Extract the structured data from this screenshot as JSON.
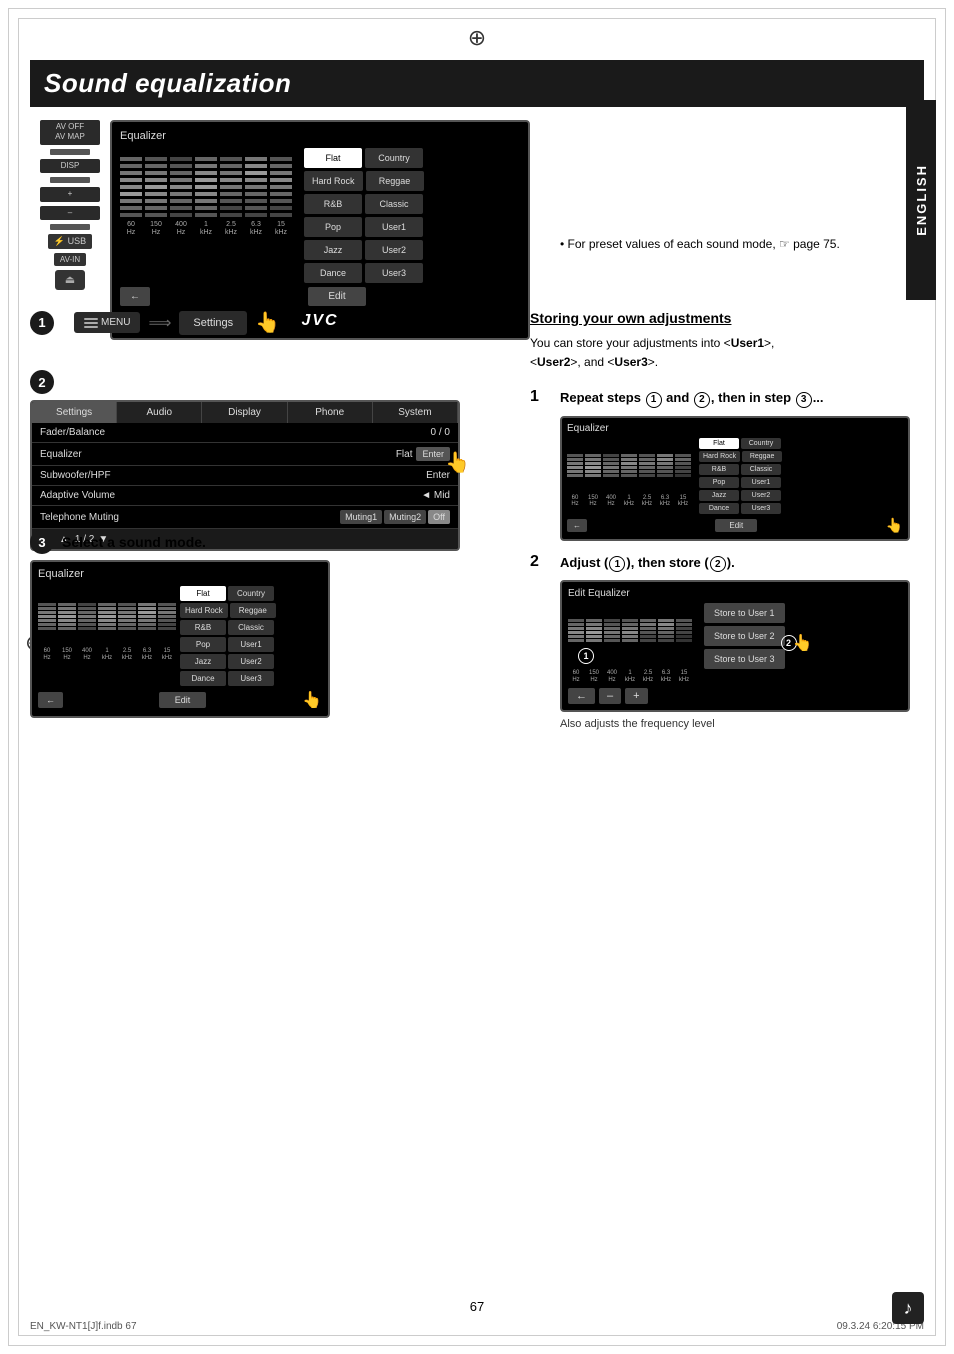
{
  "page": {
    "title": "Sound equalization",
    "page_number": "67",
    "footer_left": "EN_KW-NT1[J]f.indb   67",
    "footer_right": "09.3.24   6:20:15 PM"
  },
  "sidebar": {
    "label": "ENGLISH"
  },
  "device": {
    "buttons": [
      "AV OFF",
      "AV MAP",
      "DISP",
      "+",
      "–",
      "USB",
      "AV-IN"
    ]
  },
  "eq_main": {
    "title": "Equalizer",
    "labels": [
      "60 Hz",
      "150 Hz",
      "400 Hz",
      "1 kHz",
      "2.5 kHz",
      "6.3 kHz",
      "15 kHz"
    ],
    "buttons": {
      "flat": "Flat",
      "country": "Country",
      "hard_rock": "Hard Rock",
      "reggae": "Reggae",
      "rb": "R&B",
      "classic": "Classic",
      "pop": "Pop",
      "user1": "User1",
      "jazz": "Jazz",
      "user2": "User2",
      "dance": "Dance",
      "user3": "User3"
    },
    "bottom": {
      "back": "←",
      "edit": "Edit"
    },
    "logo": "JVC"
  },
  "note": {
    "text": "For preset values of each sound mode, ☞ page 75."
  },
  "step1": {
    "circle": "1",
    "menu_label": "MENU",
    "settings_label": "Settings"
  },
  "step2": {
    "circle": "2",
    "screen": {
      "tabs": [
        "Settings",
        "Audio",
        "Display",
        "Phone",
        "System"
      ],
      "rows": [
        {
          "label": "Fader/Balance",
          "value": "0 / 0"
        },
        {
          "label": "Equalizer",
          "value": "Flat"
        },
        {
          "label": "Subwoofer/HPF",
          "value": "Enter"
        },
        {
          "label": "Adaptive Volume",
          "value": "◄  Mid"
        },
        {
          "label": "Telephone Muting",
          "value": "Muting1  Muting2  Off"
        }
      ],
      "bottom": {
        "back": "←",
        "page": "1 / 2",
        "nav_up": "▲",
        "nav_down": "▼"
      }
    }
  },
  "step3": {
    "circle": "3",
    "label": "Select a sound mode.",
    "eq_title": "Equalizer",
    "buttons": {
      "flat": "Flat",
      "country": "Country",
      "hard_rock": "Hard Rock",
      "reggae": "Reggae",
      "rb": "R&B",
      "classic": "Classic",
      "pop": "Pop",
      "user1": "User1",
      "jazz": "Jazz",
      "user2": "User2",
      "dance": "Dance",
      "user3": "User3"
    },
    "edit": "Edit"
  },
  "storing": {
    "title": "Storing your own adjustments",
    "text": "You can store your adjustments into <User1>, <User2>, and <User3>.",
    "step1": {
      "num": "1",
      "label": "Repeat steps",
      "detail": " and , then in step ..."
    },
    "step2": {
      "num": "2",
      "label": "Adjust (",
      "circle1": "1",
      "mid": "), then store (",
      "circle2": "2",
      "end": ")."
    },
    "eq_title": "Equalizer",
    "edit_eq_title": "Edit Equalizer",
    "store_buttons": [
      "Store to User 1",
      "Store to User 2",
      "Store to User 3"
    ],
    "also_adjusts": "Also adjusts the frequency level",
    "edit_bottom": {
      "back": "←",
      "minus": "–",
      "plus": "+"
    }
  }
}
